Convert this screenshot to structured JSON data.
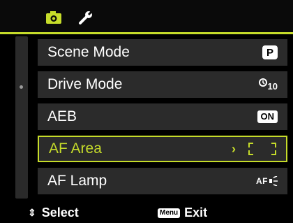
{
  "tabs": [
    {
      "icon": "camera-icon",
      "active": true
    },
    {
      "icon": "wrench-icon",
      "active": false
    }
  ],
  "accent_color": "#c6dc2a",
  "menu": {
    "items": [
      {
        "label": "Scene Mode",
        "value": "P",
        "value_icon": "program-mode-icon"
      },
      {
        "label": "Drive Mode",
        "value": "10",
        "value_icon": "self-timer-icon"
      },
      {
        "label": "AEB",
        "value": "ON",
        "value_icon": "on-badge-icon"
      },
      {
        "label": "AF Area",
        "value_icon": "af-area-bracket-icon",
        "selected": true
      },
      {
        "label": "AF Lamp",
        "value": "AF",
        "value_icon": "af-lamp-icon"
      }
    ]
  },
  "footer": {
    "select_label": "Select",
    "menu_key": "Menu",
    "exit_label": "Exit"
  }
}
